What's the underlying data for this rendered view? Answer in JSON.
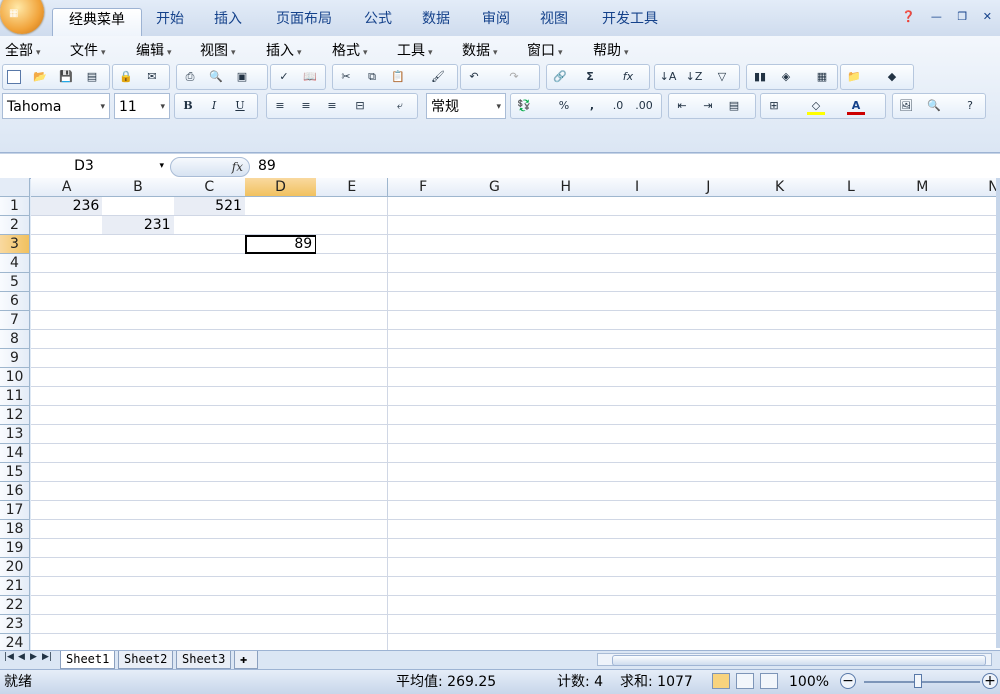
{
  "ribbon": {
    "tabs": [
      "经典菜单",
      "开始",
      "插入",
      "页面布局",
      "公式",
      "数据",
      "审阅",
      "视图",
      "开发工具"
    ],
    "active_tab": "经典菜单"
  },
  "menubar": {
    "items": [
      "全部",
      "文件",
      "编辑",
      "视图",
      "插入",
      "格式",
      "工具",
      "数据",
      "窗口",
      "帮助"
    ]
  },
  "format": {
    "font_name": "Tahoma",
    "font_size": "11",
    "bold": "B",
    "italic": "I",
    "underline": "U",
    "number_format": "常规",
    "percent": "%",
    "comma": ",",
    "font_color": "#cc0000",
    "fill_color": "#ffff00"
  },
  "formula_bar": {
    "name_box": "D3",
    "fx": "fx",
    "value": "89"
  },
  "columns": [
    "A",
    "B",
    "C",
    "D",
    "E",
    "F",
    "G",
    "H",
    "I",
    "J",
    "K",
    "L",
    "M",
    "N"
  ],
  "rows": [
    "1",
    "2",
    "3",
    "4",
    "5",
    "6",
    "7",
    "8",
    "9",
    "10",
    "11",
    "12",
    "13",
    "14",
    "15",
    "16",
    "17",
    "18",
    "19",
    "20",
    "21",
    "22",
    "23",
    "24"
  ],
  "cells": {
    "A1": "236",
    "C1": "521",
    "B2": "231",
    "D3": "89"
  },
  "active_cell": "D3",
  "sheets": [
    "Sheet1",
    "Sheet2",
    "Sheet3"
  ],
  "active_sheet": "Sheet1",
  "status": {
    "ready": "就绪",
    "average": "平均值: 269.25",
    "count": "计数: 4",
    "sum": "求和: 1077",
    "zoom": "100%"
  }
}
